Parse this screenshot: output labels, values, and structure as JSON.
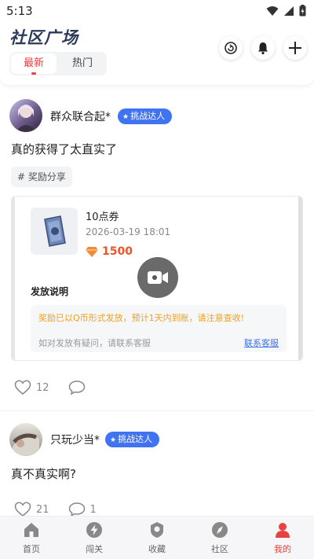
{
  "status_bar": {
    "time": "5:13"
  },
  "header": {
    "title": "社区广场",
    "tabs": [
      {
        "label": "最新",
        "active": true
      },
      {
        "label": "热门",
        "active": false
      }
    ]
  },
  "posts": [
    {
      "username": "群众联合起*",
      "badge": "挑战达人",
      "text": "真的获得了太直实了",
      "tag": "# 奖励分享",
      "reward_card": {
        "coupon_name": "10点券",
        "date": "2026-03-19 18:01",
        "price": "1500",
        "section_title": "发放说明",
        "notice": "奖励已以Q币形式发放，预计1天内到账，请注意查收!",
        "help_text": "如对发放有疑问，请联系客服",
        "link_text": "联系客服"
      },
      "likes": "12"
    },
    {
      "username": "只玩少当*",
      "badge": "挑战达人",
      "text": "真不真实啊?",
      "likes": "21",
      "comments": "1"
    }
  ],
  "bottom_nav": [
    {
      "label": "首页",
      "icon": "home-icon"
    },
    {
      "label": "闯关",
      "icon": "lightning-icon"
    },
    {
      "label": "收藏",
      "icon": "bookmark-icon"
    },
    {
      "label": "社区",
      "icon": "compass-icon"
    },
    {
      "label": "我的",
      "icon": "person-icon",
      "active": true
    }
  ],
  "colors": {
    "accent": "#e84141",
    "badge_blue": "#3f73f2",
    "price_orange": "#e8552e",
    "warn": "#f0a020"
  }
}
